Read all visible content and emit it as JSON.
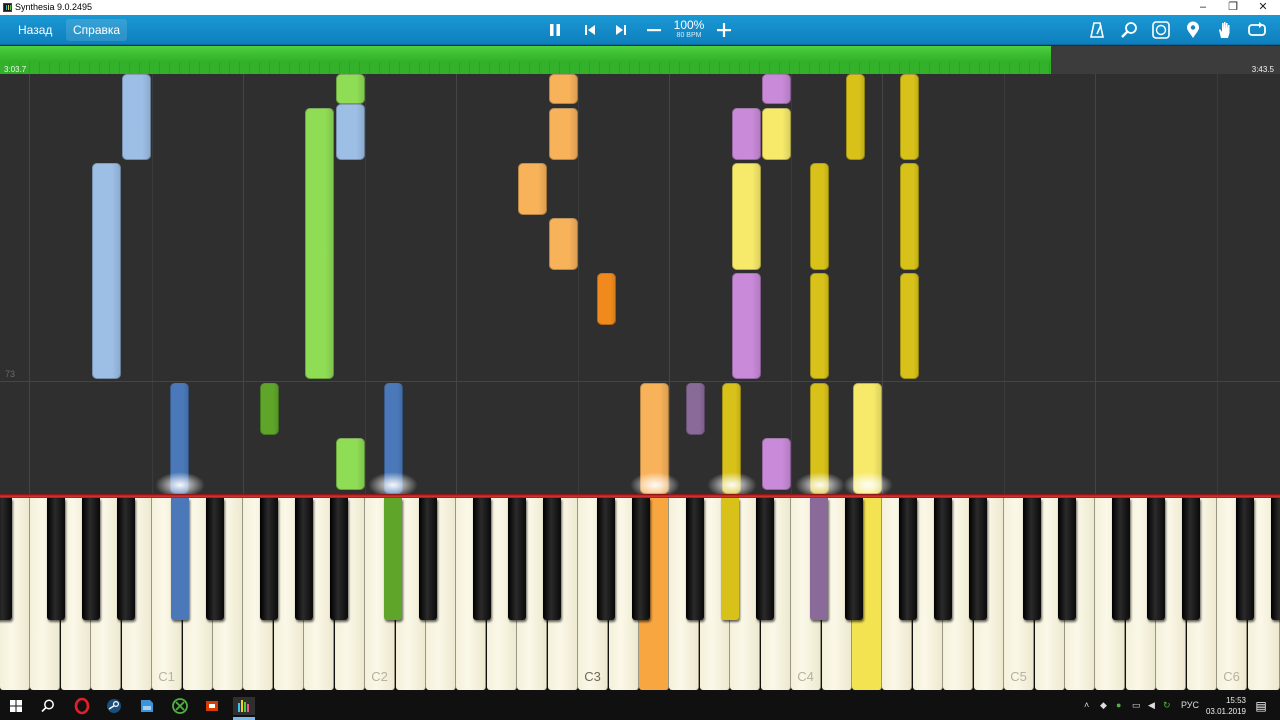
{
  "window": {
    "title": "Synthesia 9.0.2495",
    "minimize_icon": "minimize-icon",
    "restore_icon": "restore-icon",
    "close_icon": "close-icon"
  },
  "toolbar": {
    "back_label": "Назад",
    "help_label": "Справка",
    "speed_percent": "100%",
    "tempo": "80 BPM",
    "icons": [
      "pause-icon",
      "previous-icon",
      "next-icon",
      "minus-icon",
      "plus-icon",
      "metronome-icon",
      "zoom-icon",
      "notation-icon",
      "marker-icon",
      "hand-icon",
      "loop-icon"
    ]
  },
  "progress": {
    "elapsed": "3:03.7",
    "total": "3:43.5",
    "fraction": 0.821,
    "color": "#33b12a"
  },
  "notes": {
    "measure_number": "73",
    "colors": {
      "light_blue": "#9dbfe6",
      "blue": "#4a78b8",
      "light_green": "#8fdd55",
      "green": "#5fa52a",
      "orange_light": "#f7b25a",
      "orange": "#f08a1c",
      "purple_light": "#c98ad9",
      "purple": "#8a6a98",
      "yellow_light": "#f7ea6a",
      "yellow": "#d8c21a"
    }
  },
  "keyboard": {
    "octave_labels": [
      "C1",
      "C2",
      "C3",
      "C4",
      "C5",
      "C6"
    ],
    "pressed_colors": {
      "blue": "#4a78b8",
      "green": "#5fa52a",
      "orange": "#f7a640",
      "yellow_dark": "#d8c21a",
      "purple": "#8a6a98",
      "yellow": "#f3e350"
    }
  },
  "taskbar": {
    "icons": [
      "windows-start-icon",
      "search-icon",
      "opera-icon",
      "steam-icon",
      "file-manager-icon",
      "xbox-icon",
      "office-icon",
      "synthesia-icon"
    ],
    "language": "РУС",
    "time": "15:53",
    "date": "03.01.2019"
  }
}
